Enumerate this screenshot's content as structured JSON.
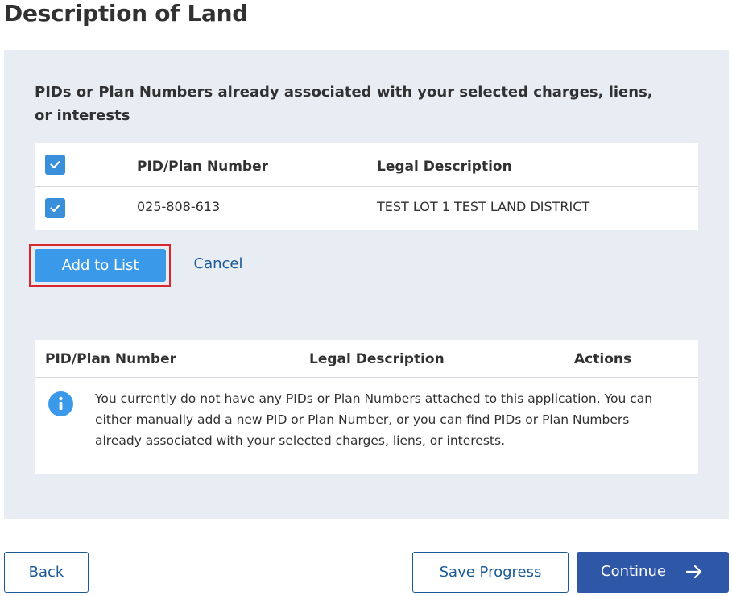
{
  "page": {
    "title": "Description of Land"
  },
  "associated": {
    "heading": "PIDs or Plan Numbers already associated with your selected charges, liens, or interests",
    "headers": {
      "pid": "PID/Plan Number",
      "legal": "Legal Description"
    },
    "header_checked": true,
    "rows": [
      {
        "checked": true,
        "pid": "025-808-613",
        "legal": "TEST LOT 1 TEST LAND DISTRICT"
      }
    ],
    "add_label": "Add to List",
    "cancel_label": "Cancel"
  },
  "attached": {
    "headers": {
      "pid": "PID/Plan Number",
      "legal": "Legal Description",
      "actions": "Actions"
    },
    "empty_message": "You currently do not have any PIDs or Plan Numbers attached to this application. You can either manually add a new PID or Plan Number, or you can find PIDs or Plan Numbers already associated with your selected charges, liens, or interests.",
    "info_icon": "info-icon"
  },
  "footer": {
    "back_label": "Back",
    "save_label": "Save Progress",
    "continue_label": "Continue",
    "continue_icon": "arrow-right-icon"
  },
  "colors": {
    "primary": "#2f57a8",
    "accent": "#3a99e8",
    "panel_bg": "#e8ecf3",
    "highlight": "#d8272d",
    "link": "#1a5a96"
  }
}
